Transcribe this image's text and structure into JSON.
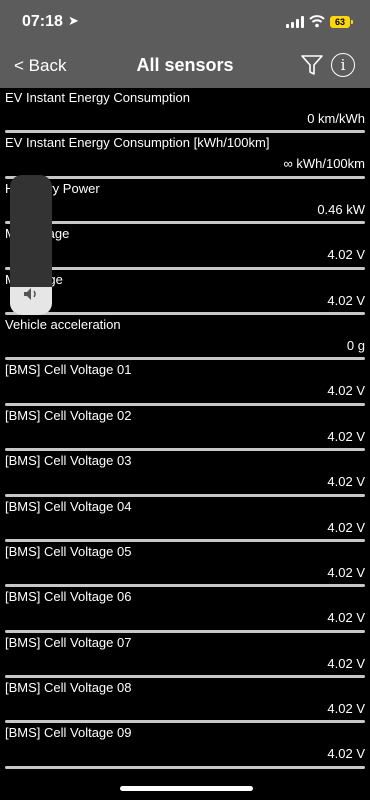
{
  "status": {
    "time": "07:18",
    "battery": "63"
  },
  "nav": {
    "back_label": "< Back",
    "title": "All sensors"
  },
  "volume": {
    "level_percent": 20
  },
  "sensors": [
    {
      "label": "EV Instant Energy Consumption",
      "value": "0 km/kWh"
    },
    {
      "label": "EV Instant Energy Consumption [kWh/100km]",
      "value": "∞ kWh/100km"
    },
    {
      "label": "H        Battery Power",
      "value": "0.46 kW"
    },
    {
      "label": "M        l Voltage",
      "value": "4.02 V"
    },
    {
      "label": "M        Voltage",
      "value": "4.02 V"
    },
    {
      "label": "Vehicle acceleration",
      "value": "0 g"
    },
    {
      "label": "[BMS] Cell Voltage 01",
      "value": "4.02 V"
    },
    {
      "label": "[BMS] Cell Voltage 02",
      "value": "4.02 V"
    },
    {
      "label": "[BMS] Cell Voltage 03",
      "value": "4.02 V"
    },
    {
      "label": "[BMS] Cell Voltage 04",
      "value": "4.02 V"
    },
    {
      "label": "[BMS] Cell Voltage 05",
      "value": "4.02 V"
    },
    {
      "label": "[BMS] Cell Voltage 06",
      "value": "4.02 V"
    },
    {
      "label": "[BMS] Cell Voltage 07",
      "value": "4.02 V"
    },
    {
      "label": "[BMS] Cell Voltage 08",
      "value": "4.02 V"
    },
    {
      "label": "[BMS] Cell Voltage 09",
      "value": "4.02 V"
    }
  ]
}
